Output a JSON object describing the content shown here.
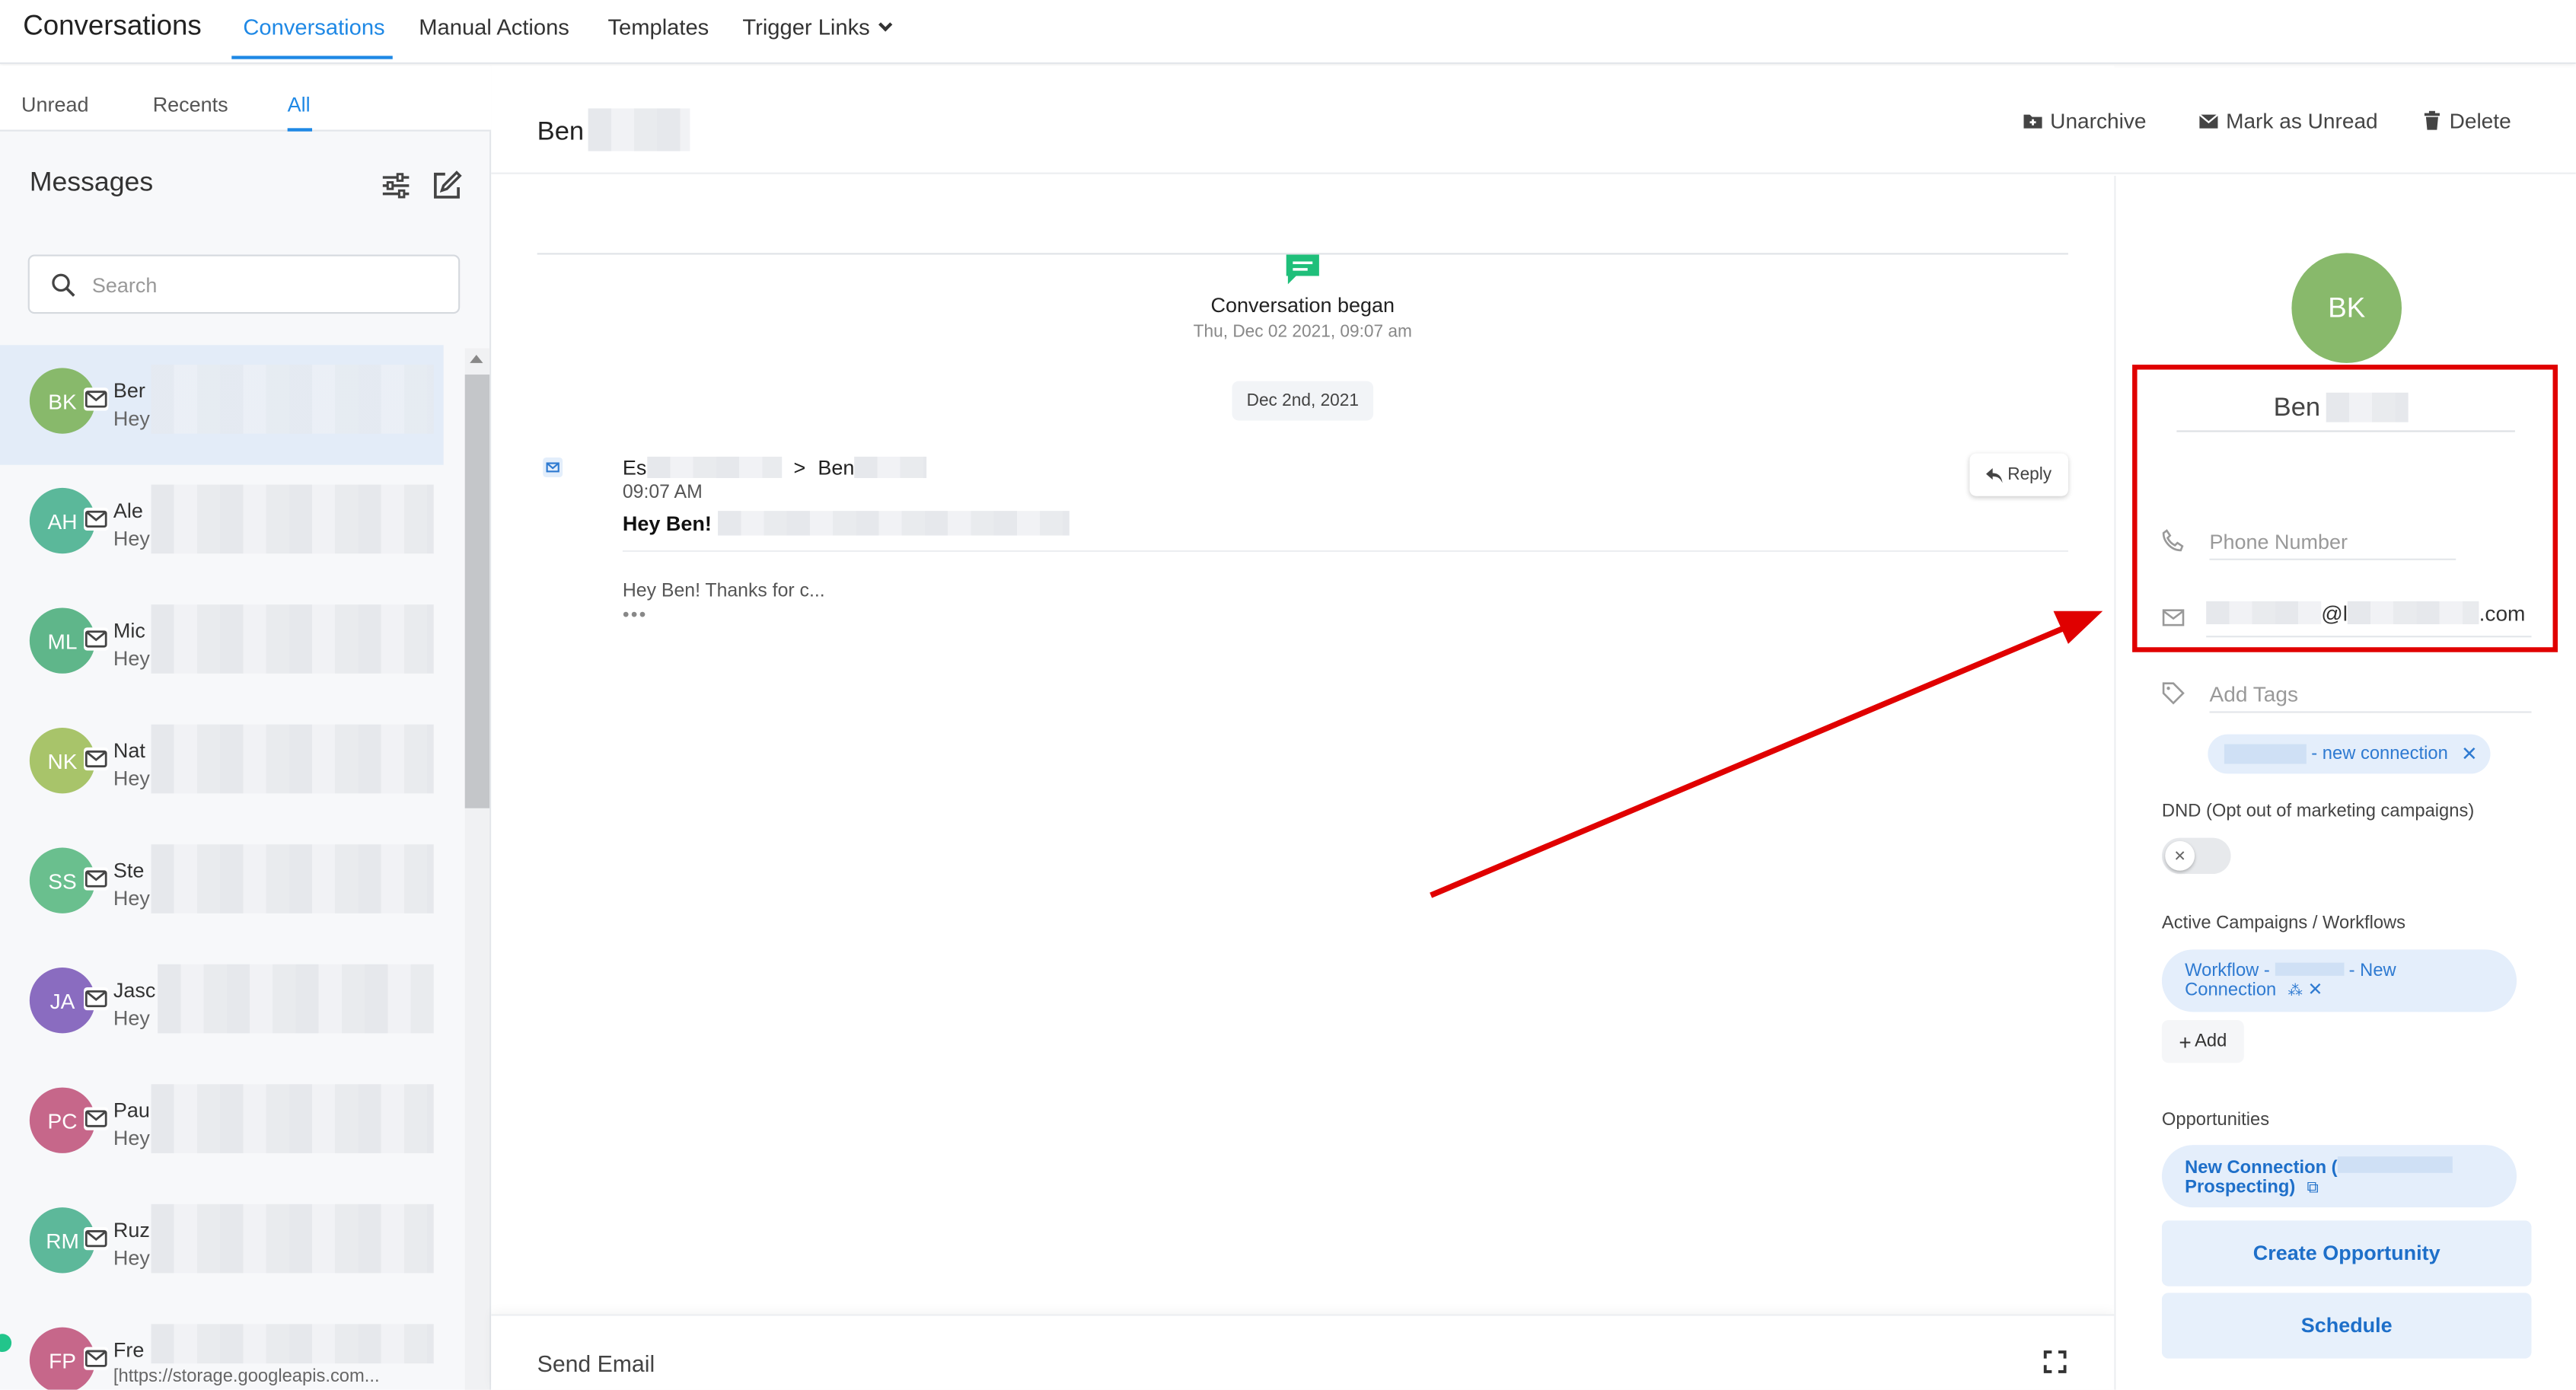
{
  "app": {
    "title": "Conversations"
  },
  "topnav": {
    "tabs": [
      {
        "label": "Conversations"
      },
      {
        "label": "Manual Actions"
      },
      {
        "label": "Templates"
      },
      {
        "label": "Trigger Links"
      }
    ]
  },
  "left": {
    "subtabs": [
      {
        "label": "Unread"
      },
      {
        "label": "Recents"
      },
      {
        "label": "All"
      }
    ],
    "messages_title": "Messages",
    "search": {
      "placeholder": "Search"
    },
    "conversations": [
      {
        "initials": "BK",
        "name": "Ber",
        "preview": "Hey",
        "color": "#88b96b"
      },
      {
        "initials": "AH",
        "name": "Ale",
        "preview": "Hey",
        "color": "#5bb89a"
      },
      {
        "initials": "ML",
        "name": "Mic",
        "preview": "Hey",
        "color": "#5fb68a"
      },
      {
        "initials": "NK",
        "name": "Nat",
        "preview": "Hey",
        "color": "#a8c46a"
      },
      {
        "initials": "SS",
        "name": "Ste",
        "preview": "Hey",
        "color": "#6abf8e"
      },
      {
        "initials": "JA",
        "name": "Jasc",
        "preview": "Hey",
        "color": "#8a6cc0"
      },
      {
        "initials": "PC",
        "name": "Pau",
        "preview": "Hey",
        "color": "#c6678a"
      },
      {
        "initials": "RM",
        "name": "Ruz",
        "preview": "Hey",
        "color": "#5db89a"
      },
      {
        "initials": "FP",
        "name": "Fre",
        "preview": "[https://storage.googleapis.com...",
        "color": "#c6678a"
      }
    ]
  },
  "center": {
    "contact_name": "Ben",
    "actions": {
      "unarchive": "Unarchive",
      "mark_unread": "Mark as Unread",
      "delete": "Delete"
    },
    "conversation_began": "Conversation began",
    "began_time": "Thu, Dec 02 2021, 09:07 am",
    "date_pill": "Dec 2nd, 2021",
    "message": {
      "from_prefix": "Es",
      "arrow": ">",
      "to": "Ben",
      "time": "09:07 AM",
      "subject": "Hey Ben!",
      "body": "Hey Ben! Thanks for c...",
      "more": "•••",
      "reply_label": "Reply"
    },
    "composer_label": "Send Email"
  },
  "right": {
    "initials": "BK",
    "name": "Ben",
    "phone_placeholder": "Phone Number",
    "email_at": "@l",
    "email_tail": ".com",
    "tags_placeholder": "Add Tags",
    "tag_chip": "- new connection",
    "dnd_label": "DND (Opt out of marketing campaigns)",
    "campaigns_label": "Active Campaigns / Workflows",
    "workflow_line1": "Workflow -",
    "workflow_line1b": "- New",
    "workflow_line2": "Connection",
    "add_label": "Add",
    "opportunities_label": "Opportunities",
    "opp_line1": "New Connection (",
    "opp_line2": "Prospecting)",
    "create_opportunity": "Create Opportunity",
    "schedule": "Schedule"
  },
  "colors": {
    "accent": "#1e88e5",
    "annotation": "#e00000",
    "avatar_bk": "#88b96b"
  }
}
